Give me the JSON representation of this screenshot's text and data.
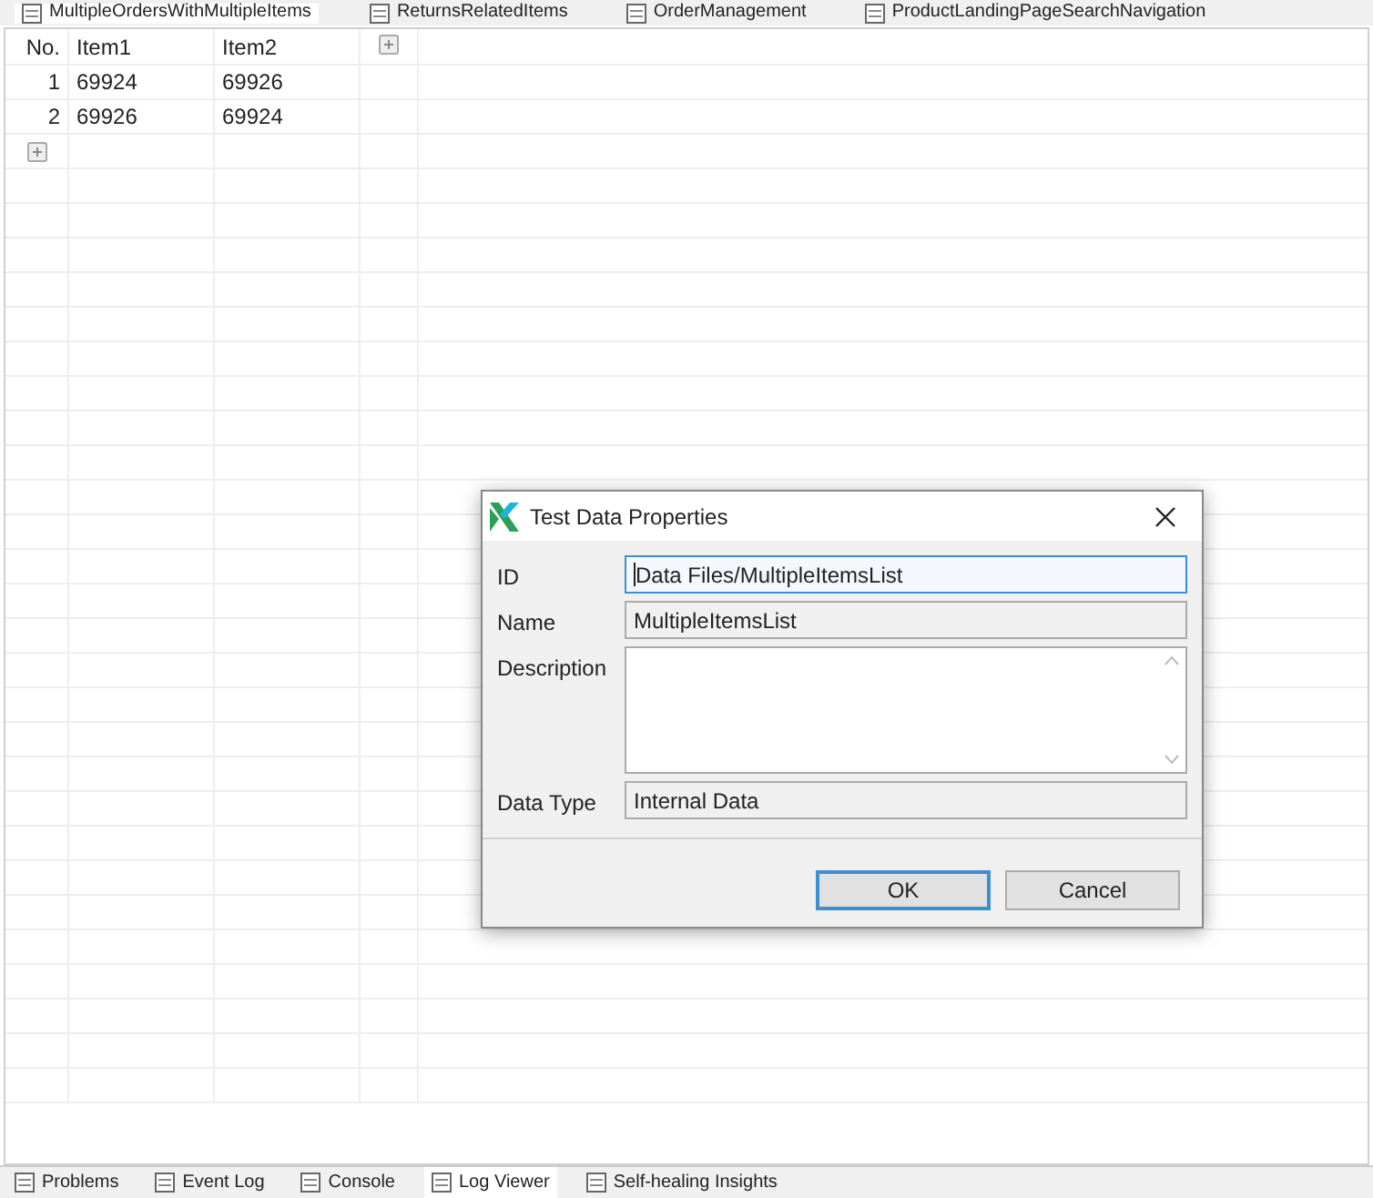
{
  "editor_tabs": [
    {
      "label": "MultipleOrdersWithMultipleItems",
      "selected": true
    },
    {
      "label": "ReturnsRelatedItems",
      "selected": false
    },
    {
      "label": "OrderManagement",
      "selected": false
    },
    {
      "label": "ProductLandingPageSearchNavigation",
      "selected": false
    }
  ],
  "table": {
    "columns": [
      "No.",
      "Item1",
      "Item2"
    ],
    "rows": [
      [
        "1",
        "69924",
        "69926"
      ],
      [
        "2",
        "69926",
        "69924"
      ]
    ]
  },
  "dialog": {
    "title": "Test Data Properties",
    "fields": [
      {
        "label": "ID",
        "value": "Data Files/MultipleItemsList",
        "kind": "text",
        "focused": true
      },
      {
        "label": "Name",
        "value": "MultipleItemsList",
        "kind": "text",
        "focused": false
      },
      {
        "label": "Description",
        "kind": "textarea",
        "focused": false
      },
      {
        "label": "Data Type",
        "value": "Internal Data",
        "kind": "text",
        "focused": false
      }
    ],
    "buttons": [
      {
        "label": "OK",
        "default": true
      },
      {
        "label": "Cancel",
        "default": false
      }
    ]
  },
  "bottom_tabs": [
    {
      "label": "Problems",
      "selected": false
    },
    {
      "label": "Event Log",
      "selected": false
    },
    {
      "label": "Console",
      "selected": false
    },
    {
      "label": "Log Viewer",
      "selected": true
    },
    {
      "label": "Self-healing Insights",
      "selected": false
    }
  ]
}
